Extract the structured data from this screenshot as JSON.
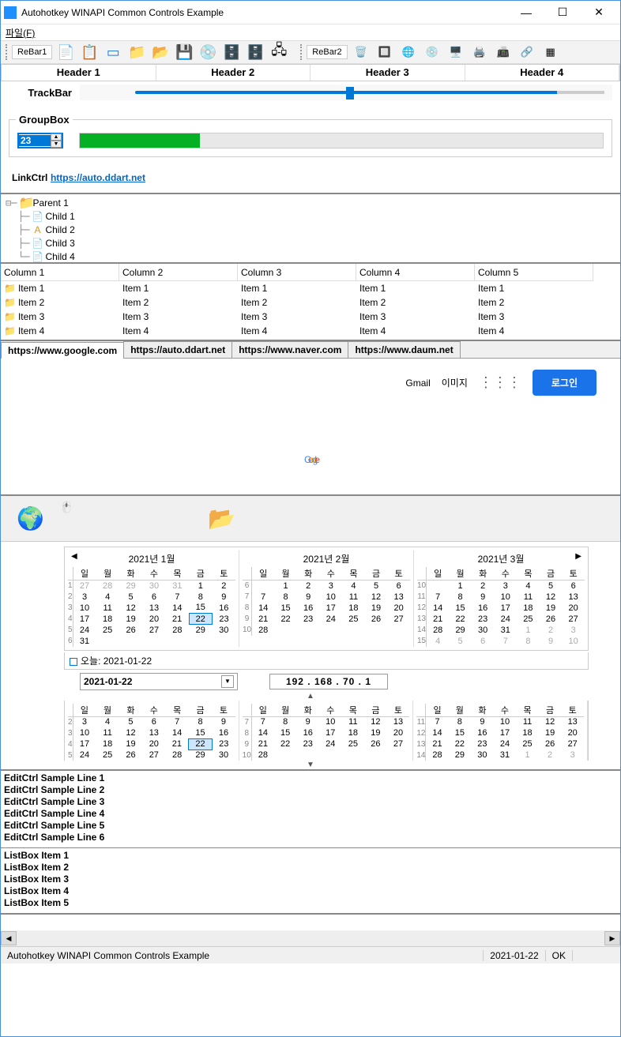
{
  "window": {
    "title": "Autohotkey WINAPI Common Controls Example"
  },
  "menu": {
    "file": "파일(F)"
  },
  "rebar": {
    "label1": "ReBar1",
    "label2": "ReBar2"
  },
  "headers": [
    "Header 1",
    "Header 2",
    "Header 3",
    "Header 4"
  ],
  "trackbar": {
    "label": "TrackBar"
  },
  "groupbox": {
    "title": "GroupBox",
    "spin_value": "23"
  },
  "link": {
    "label": "LinkCtrl",
    "url": "https://auto.ddart.net"
  },
  "tree": {
    "parent": "Parent 1",
    "children": [
      "Child 1",
      "Child 2",
      "Child 3",
      "Child 4"
    ]
  },
  "listview": {
    "columns": [
      "Column 1",
      "Column 2",
      "Column 3",
      "Column 4",
      "Column 5"
    ],
    "rows": [
      [
        "Item 1",
        "Item 1",
        "Item 1",
        "Item 1",
        "Item 1"
      ],
      [
        "Item 2",
        "Item 2",
        "Item 2",
        "Item 2",
        "Item 2"
      ],
      [
        "Item 3",
        "Item 3",
        "Item 3",
        "Item 3",
        "Item 3"
      ],
      [
        "Item 4",
        "Item 4",
        "Item 4",
        "Item 4",
        "Item 4"
      ]
    ]
  },
  "tabs": [
    "https://www.google.com",
    "https://auto.ddart.net",
    "https://www.naver.com",
    "https://www.daum.net"
  ],
  "google": {
    "gmail": "Gmail",
    "images": "이미지",
    "login": "로그인"
  },
  "calendar": {
    "months": [
      "2021년 1월",
      "2021년 2월",
      "2021년 3월"
    ],
    "days": [
      "일",
      "월",
      "화",
      "수",
      "목",
      "금",
      "토"
    ],
    "today_label": "오늘: 2021-01-22",
    "today_day": 22,
    "jan_weeks": [
      {
        "w": 1,
        "d": [
          "27",
          "28",
          "29",
          "30",
          "31",
          "1",
          "2"
        ],
        "other": [
          0,
          1,
          2,
          3,
          4
        ]
      },
      {
        "w": 2,
        "d": [
          "3",
          "4",
          "5",
          "6",
          "7",
          "8",
          "9"
        ]
      },
      {
        "w": 3,
        "d": [
          "10",
          "11",
          "12",
          "13",
          "14",
          "15",
          "16"
        ]
      },
      {
        "w": 4,
        "d": [
          "17",
          "18",
          "19",
          "20",
          "21",
          "22",
          "23"
        ]
      },
      {
        "w": 5,
        "d": [
          "24",
          "25",
          "26",
          "27",
          "28",
          "29",
          "30"
        ]
      },
      {
        "w": 6,
        "d": [
          "31",
          "",
          "",
          "",
          "",
          "",
          ""
        ]
      }
    ],
    "feb_weeks": [
      {
        "w": 6,
        "d": [
          "",
          "1",
          "2",
          "3",
          "4",
          "5",
          "6"
        ]
      },
      {
        "w": 7,
        "d": [
          "7",
          "8",
          "9",
          "10",
          "11",
          "12",
          "13"
        ]
      },
      {
        "w": 8,
        "d": [
          "14",
          "15",
          "16",
          "17",
          "18",
          "19",
          "20"
        ]
      },
      {
        "w": 9,
        "d": [
          "21",
          "22",
          "23",
          "24",
          "25",
          "26",
          "27"
        ]
      },
      {
        "w": 10,
        "d": [
          "28",
          "",
          "",
          "",
          "",
          "",
          ""
        ]
      }
    ],
    "mar_weeks": [
      {
        "w": 10,
        "d": [
          "",
          "1",
          "2",
          "3",
          "4",
          "5",
          "6"
        ]
      },
      {
        "w": 11,
        "d": [
          "7",
          "8",
          "9",
          "10",
          "11",
          "12",
          "13"
        ]
      },
      {
        "w": 12,
        "d": [
          "14",
          "15",
          "16",
          "17",
          "18",
          "19",
          "20"
        ]
      },
      {
        "w": 13,
        "d": [
          "21",
          "22",
          "23",
          "24",
          "25",
          "26",
          "27"
        ]
      },
      {
        "w": 14,
        "d": [
          "28",
          "29",
          "30",
          "31",
          "1",
          "2",
          "3"
        ],
        "other": [
          4,
          5,
          6
        ]
      },
      {
        "w": 15,
        "d": [
          "4",
          "5",
          "6",
          "7",
          "8",
          "9",
          "10"
        ],
        "other": [
          0,
          1,
          2,
          3,
          4,
          5,
          6
        ]
      }
    ]
  },
  "datepicker": {
    "value": "2021-01-22"
  },
  "ip": {
    "value": "192 . 168 .  70  .   1"
  },
  "edit": [
    "EditCtrl Sample Line 1",
    "EditCtrl Sample Line 2",
    "EditCtrl Sample Line 3",
    "EditCtrl Sample Line 4",
    "EditCtrl Sample Line 5",
    "EditCtrl Sample Line 6"
  ],
  "listbox": [
    "ListBox Item 1",
    "ListBox Item 2",
    "ListBox Item 3",
    "ListBox Item 4",
    "ListBox Item 5"
  ],
  "status": {
    "text": "Autohotkey WINAPI Common Controls Example",
    "date": "2021-01-22",
    "ok": "OK"
  }
}
